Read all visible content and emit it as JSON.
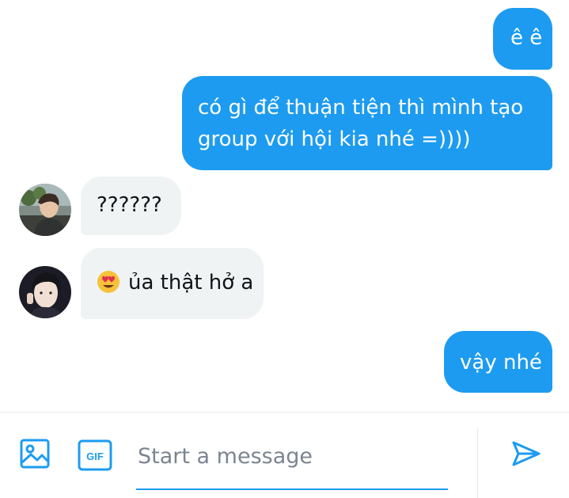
{
  "colors": {
    "accent": "#1d9bf0",
    "incoming_bubble": "#eff3f4",
    "text": "#0f1419",
    "placeholder": "#7b8590"
  },
  "messages": [
    {
      "direction": "outgoing",
      "text": "ê ê"
    },
    {
      "direction": "outgoing",
      "text": "có gì để thuận tiện thì mình tạo group với hội kia nhé =))))"
    },
    {
      "direction": "incoming",
      "text": "??????"
    },
    {
      "direction": "incoming",
      "emoji": "heart-eyes-emoji",
      "text": "ủa thật hở a"
    },
    {
      "direction": "outgoing",
      "text": "vậy nhé"
    }
  ],
  "composer": {
    "placeholder": "Start a message",
    "media_icon": "image-icon",
    "gif_label": "GIF",
    "send_icon": "send-icon"
  }
}
